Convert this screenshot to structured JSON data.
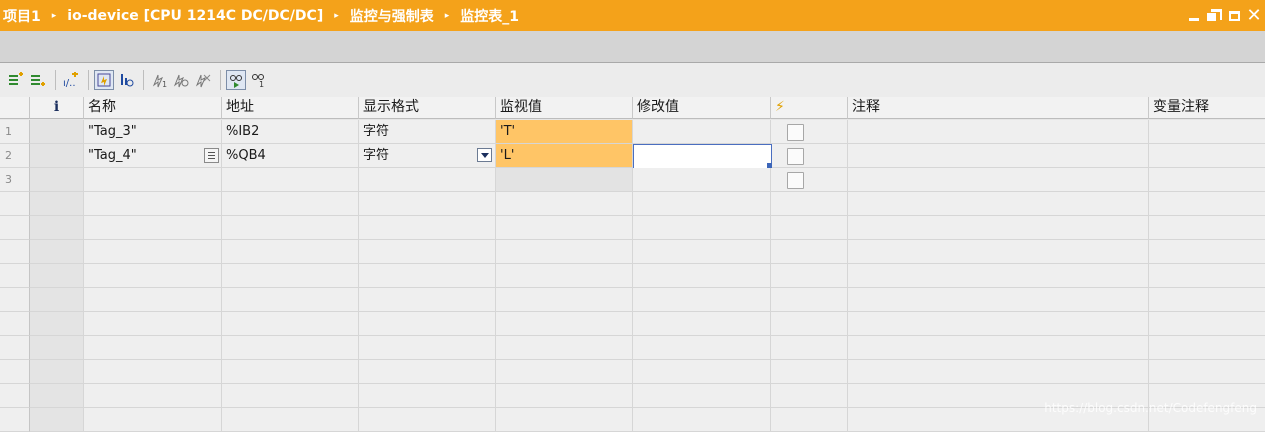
{
  "title_bar": {
    "breadcrumbs": [
      "项目1",
      "io-device [CPU 1214C DC/DC/DC]",
      "监控与强制表",
      "监控表_1"
    ],
    "separator": "▸",
    "controls": [
      "minimize-icon",
      "restore-icon",
      "maximize-icon",
      "close-icon"
    ],
    "close_glyph": "✕"
  },
  "toolbar": {
    "icons": [
      "insert-row-icon",
      "add-row-icon",
      "update-values-icon",
      "show-extended-mode-icon",
      "display-all-icon",
      "modify-now-icon",
      "modify-on-trigger-icon",
      "enable-peripheral-outputs-icon",
      "monitor-all-icon",
      "monitor-now-icon"
    ],
    "pressed": [
      "show-extended-mode-icon",
      "monitor-all-icon"
    ]
  },
  "table": {
    "columns": [
      "",
      "i",
      "名称",
      "地址",
      "显示格式",
      "监视值",
      "修改值",
      "⚡",
      "注释",
      "变量注释"
    ],
    "rows": [
      {
        "num": "1",
        "name": "\"Tag_3\"",
        "address": "%IB2",
        "format": "字符",
        "monitor": "'T'",
        "modify": "",
        "checked": false,
        "comment": "",
        "tag_comment": ""
      },
      {
        "num": "2",
        "name": "\"Tag_4\"",
        "address": "%QB4",
        "format": "字符",
        "monitor": "'L'",
        "modify": "",
        "checked": false,
        "comment": "",
        "tag_comment": ""
      },
      {
        "num": "3",
        "name": "",
        "address": "",
        "format": "",
        "monitor": "",
        "modify": "",
        "checked": false,
        "comment": "",
        "tag_comment": ""
      }
    ],
    "empty_rows": 10
  },
  "watermark": "https://blog.csdn.net/Codefengfeng",
  "colors": {
    "title_bar": "#f4a21a",
    "monitor_value_bg": "#ffc566",
    "selection_border": "#4a6ec0"
  }
}
